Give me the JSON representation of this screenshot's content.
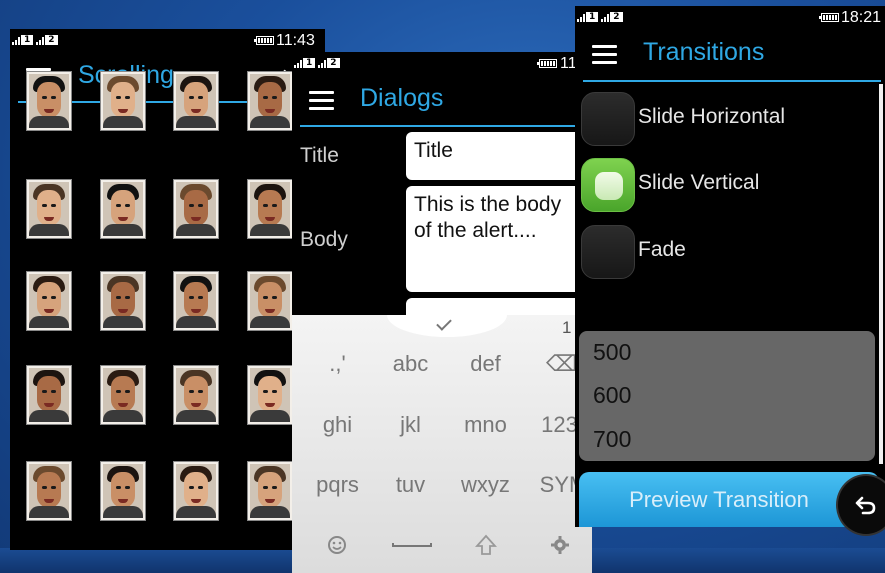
{
  "colors": {
    "accent": "#2fa8e4",
    "toggle_on": "#5cb836",
    "button": "#2aa6e4"
  },
  "scrolling": {
    "status": {
      "sim1": "1",
      "sim2": "2",
      "time": "11:43"
    },
    "title": "Scrolling",
    "faces": 20
  },
  "dialogs": {
    "status": {
      "sim1": "1",
      "sim2": "2",
      "time": "11"
    },
    "title": "Dialogs",
    "title_label": "Title",
    "title_value": "Title",
    "body_label": "Body",
    "body_value": "This is the body of the alert....",
    "keyboard": {
      "number_hint": "1",
      "rows": [
        [
          ".,'",
          "abc",
          "def",
          "⌫"
        ],
        [
          "ghi",
          "jkl",
          "mno",
          "123"
        ],
        [
          "pqrs",
          "tuv",
          "wxyz",
          "SYM"
        ]
      ],
      "bottom_icons": [
        "smiley-icon",
        "space-bar-icon",
        "shift-icon",
        "settings-icon"
      ]
    }
  },
  "transitions": {
    "status": {
      "sim1": "1",
      "sim2": "2",
      "time": "18:21"
    },
    "title": "Transitions",
    "options": [
      {
        "label": "Slide Horizontal",
        "selected": false
      },
      {
        "label": "Slide Vertical",
        "selected": true
      },
      {
        "label": "Fade",
        "selected": false
      }
    ],
    "durations": [
      "500",
      "600",
      "700"
    ],
    "preview_label": "Preview Transition"
  }
}
